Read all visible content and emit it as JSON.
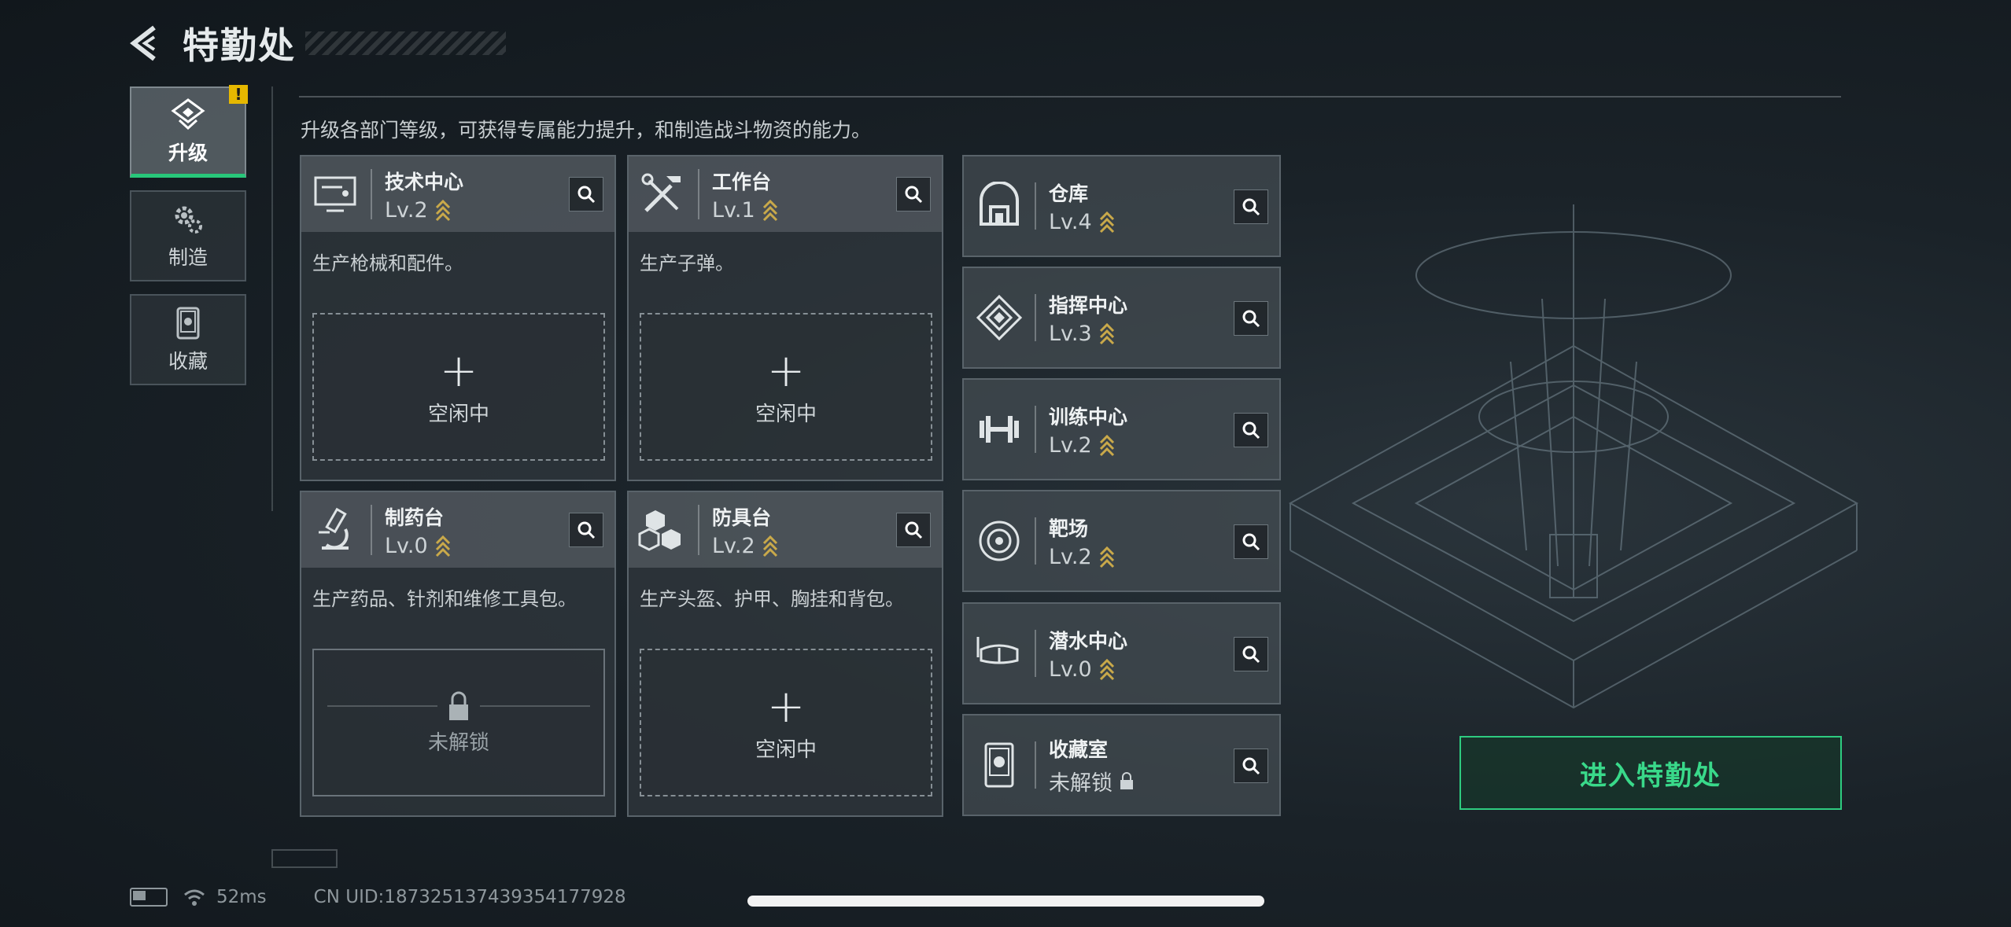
{
  "header": {
    "title": "特勤处"
  },
  "nav": {
    "items": [
      {
        "label": "升级",
        "icon": "upgrade-icon",
        "active": true,
        "badge": "!"
      },
      {
        "label": "制造",
        "icon": "gear-icon",
        "active": false
      },
      {
        "label": "收藏",
        "icon": "collection-icon",
        "active": false
      }
    ]
  },
  "subtitle": "升级各部门等级，可获得专属能力提升，和制造战斗物资的能力。",
  "cards": [
    {
      "name": "技术中心",
      "level": "Lv.2",
      "desc": "生产枪械和配件。",
      "slot": "空闲中",
      "icon": "monitor-icon"
    },
    {
      "name": "工作台",
      "level": "Lv.1",
      "desc": "生产子弹。",
      "slot": "空闲中",
      "icon": "tools-icon"
    },
    {
      "name": "制药台",
      "level": "Lv.0",
      "desc": "生产药品、针剂和维修工具包。",
      "slot": "未解锁",
      "icon": "microscope-icon"
    },
    {
      "name": "防具台",
      "level": "Lv.2",
      "desc": "生产头盔、护甲、胸挂和背包。",
      "slot": "空闲中",
      "icon": "armor-icon"
    }
  ],
  "depts": [
    {
      "name": "仓库",
      "level": "Lv.4",
      "icon": "warehouse-icon"
    },
    {
      "name": "指挥中心",
      "level": "Lv.3",
      "icon": "command-icon"
    },
    {
      "name": "训练中心",
      "level": "Lv.2",
      "icon": "dumbbell-icon"
    },
    {
      "name": "靶场",
      "level": "Lv.2",
      "icon": "target-icon"
    },
    {
      "name": "潜水中心",
      "level": "Lv.0",
      "icon": "diving-mask-icon"
    },
    {
      "name": "收藏室",
      "level": "未解锁",
      "icon": "collection-room-icon"
    }
  ],
  "enter_button": "进入特勤处",
  "status": {
    "ping": "52ms",
    "uid": "CN UID:187325137439354177928"
  },
  "colors": {
    "accent": "#2ecc80",
    "warning": "#e6b800",
    "level_chevron": "#c9a94a"
  }
}
